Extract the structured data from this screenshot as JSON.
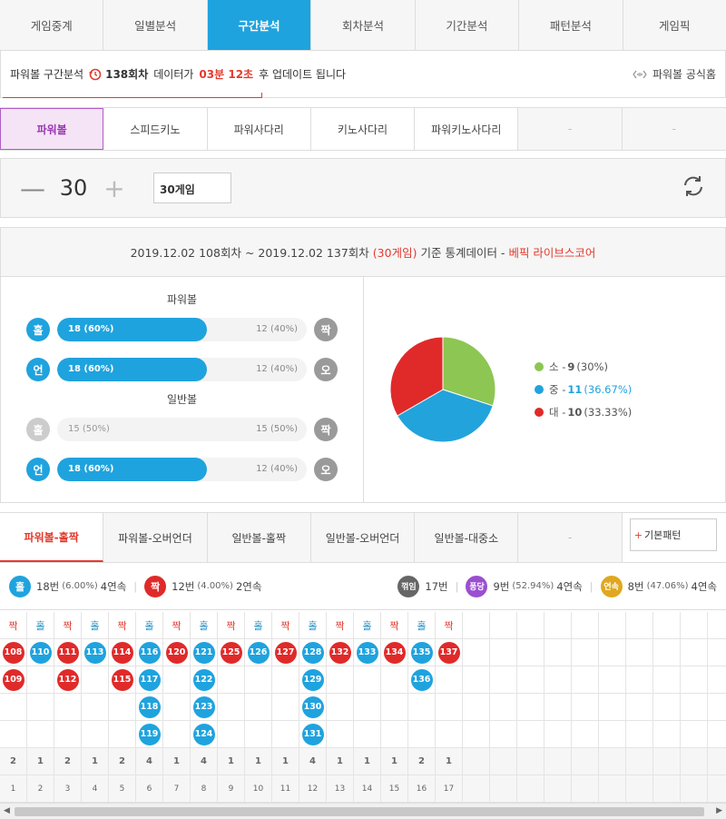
{
  "top_nav": [
    "게임중계",
    "일별분석",
    "구간분석",
    "회차분석",
    "기간분석",
    "패턴분석",
    "게임픽"
  ],
  "notice": {
    "prefix": "파워볼 구간분석",
    "round": "138회차",
    "mid": "데이터가",
    "time": "03분 12초",
    "suffix": "후 업데이트 됩니다",
    "official": "파워볼 공식홈"
  },
  "game_tabs": [
    "파워볼",
    "스피드키노",
    "파워사다리",
    "키노사다리",
    "파워키노사다리",
    "-",
    "-"
  ],
  "counter": {
    "minus": "—",
    "value": "30",
    "plus": "+",
    "select": "30게임"
  },
  "stats": {
    "header_main": "2019.12.02 108회차 ~ 2019.12.02 137회차",
    "header_games": "(30게임)",
    "header_mid": "기준 통계데이터 -",
    "header_brand": "베픽 라이브스코어",
    "powerball_label": "파워볼",
    "normal_label": "일반볼",
    "bars": [
      {
        "left": "홀",
        "right": "짝",
        "left_text": "18 (60%)",
        "right_text": "12 (40%)",
        "fill": 0.6,
        "active": true
      },
      {
        "left": "언",
        "right": "오",
        "left_text": "18 (60%)",
        "right_text": "12 (40%)",
        "fill": 0.6,
        "active": true
      },
      {
        "left": "홀",
        "right": "짝",
        "left_text": "15 (50%)",
        "right_text": "15 (50%)",
        "fill": 0.5,
        "active": false
      },
      {
        "left": "언",
        "right": "오",
        "left_text": "18 (60%)",
        "right_text": "12 (40%)",
        "fill": 0.6,
        "active": true
      }
    ],
    "pie": [
      {
        "label": "소",
        "value": 9,
        "pct": "(30%)",
        "color": "#8dc653"
      },
      {
        "label": "중",
        "value": 11,
        "pct": "(36.67%)",
        "color": "#22a3dc"
      },
      {
        "label": "대",
        "value": 10,
        "pct": "(33.33%)",
        "color": "#e02a2a"
      }
    ]
  },
  "pattern_tabs": [
    "파워볼-홀짝",
    "파워볼-오버언더",
    "일반볼-홀짝",
    "일반볼-오버언더",
    "일반볼-대중소",
    "-"
  ],
  "pattern_button": {
    "plus": "+",
    "label": "기본패턴"
  },
  "summary": {
    "odd": {
      "icon": "홀",
      "count": "18번",
      "detail": "(6.00%)",
      "streak": "4연속"
    },
    "even": {
      "icon": "짝",
      "count": "12번",
      "detail": "(4.00%)",
      "streak": "2연속"
    },
    "break": {
      "icon": "꺾임",
      "count": "17번"
    },
    "pong": {
      "icon": "퐁당",
      "count": "9번",
      "detail": "(52.94%)",
      "streak": "4연속"
    },
    "cont": {
      "icon": "연속",
      "count": "8번",
      "detail": "(47.06%)",
      "streak": "4연속"
    }
  },
  "grid": [
    {
      "head": "짝",
      "type": "even",
      "balls": [
        "108",
        "109"
      ],
      "count": "2",
      "idx": "1"
    },
    {
      "head": "홀",
      "type": "odd",
      "balls": [
        "110"
      ],
      "count": "1",
      "idx": "2"
    },
    {
      "head": "짝",
      "type": "even",
      "balls": [
        "111",
        "112"
      ],
      "count": "2",
      "idx": "3"
    },
    {
      "head": "홀",
      "type": "odd",
      "balls": [
        "113"
      ],
      "count": "1",
      "idx": "4"
    },
    {
      "head": "짝",
      "type": "even",
      "balls": [
        "114",
        "115"
      ],
      "count": "2",
      "idx": "5"
    },
    {
      "head": "홀",
      "type": "odd",
      "balls": [
        "116",
        "117",
        "118",
        "119"
      ],
      "count": "4",
      "idx": "6"
    },
    {
      "head": "짝",
      "type": "even",
      "balls": [
        "120"
      ],
      "count": "1",
      "idx": "7"
    },
    {
      "head": "홀",
      "type": "odd",
      "balls": [
        "121",
        "122",
        "123",
        "124"
      ],
      "count": "4",
      "idx": "8"
    },
    {
      "head": "짝",
      "type": "even",
      "balls": [
        "125"
      ],
      "count": "1",
      "idx": "9"
    },
    {
      "head": "홀",
      "type": "odd",
      "balls": [
        "126"
      ],
      "count": "1",
      "idx": "10"
    },
    {
      "head": "짝",
      "type": "even",
      "balls": [
        "127"
      ],
      "count": "1",
      "idx": "11"
    },
    {
      "head": "홀",
      "type": "odd",
      "balls": [
        "128",
        "129",
        "130",
        "131"
      ],
      "count": "4",
      "idx": "12"
    },
    {
      "head": "짝",
      "type": "even",
      "balls": [
        "132"
      ],
      "count": "1",
      "idx": "13"
    },
    {
      "head": "홀",
      "type": "odd",
      "balls": [
        "133"
      ],
      "count": "1",
      "idx": "14"
    },
    {
      "head": "짝",
      "type": "even",
      "balls": [
        "134"
      ],
      "count": "1",
      "idx": "15"
    },
    {
      "head": "홀",
      "type": "odd",
      "balls": [
        "135",
        "136"
      ],
      "count": "2",
      "idx": "16"
    },
    {
      "head": "짝",
      "type": "even",
      "balls": [
        "137"
      ],
      "count": "1",
      "idx": "17"
    }
  ],
  "grid_empty_columns": 10,
  "scroll_arrows": {
    "left": "◀",
    "right": "▶"
  }
}
